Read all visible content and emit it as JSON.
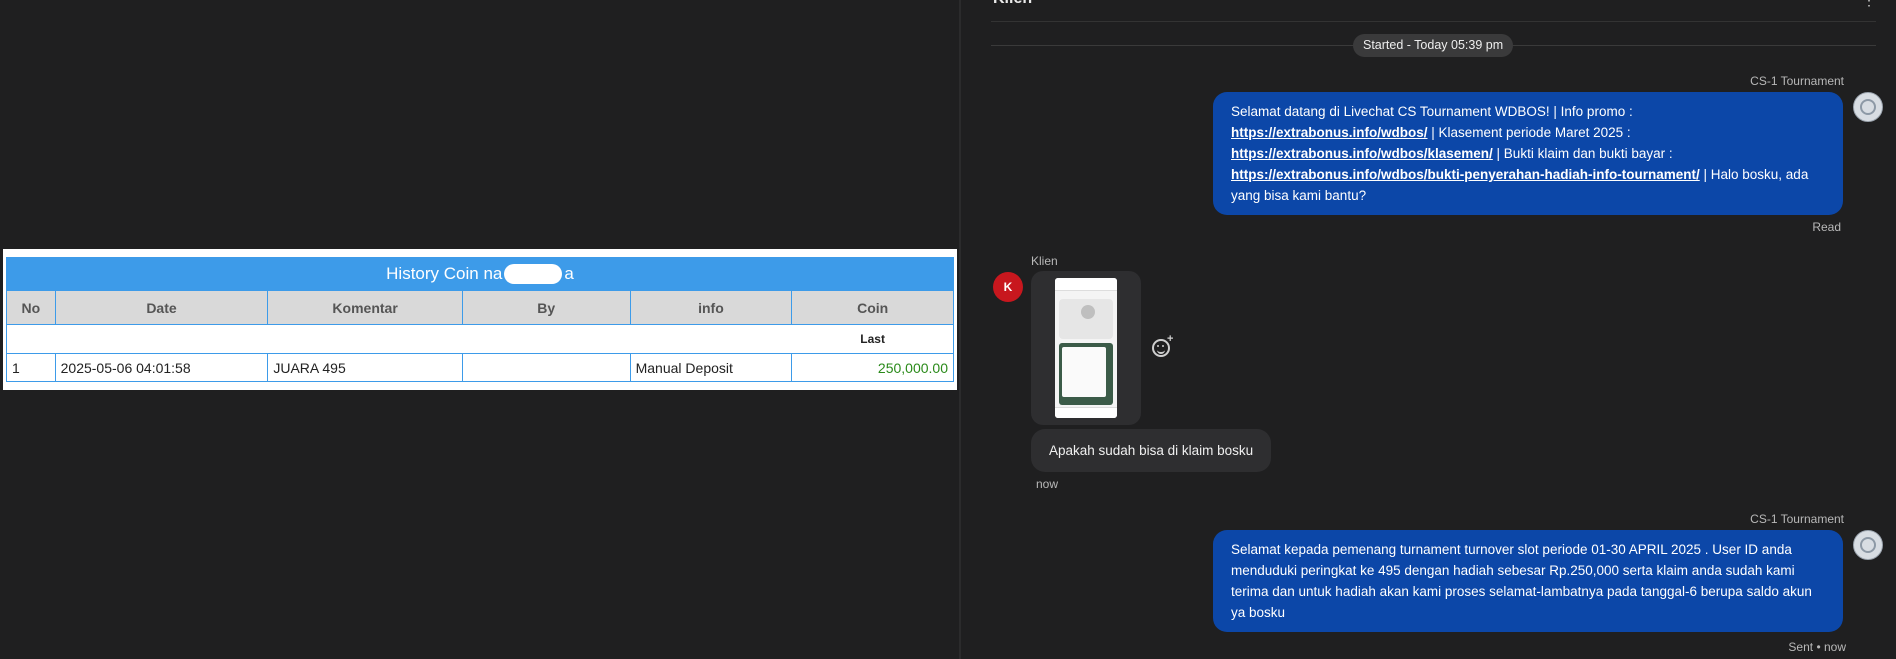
{
  "history": {
    "title_prefix": "History Coin na",
    "title_suffix": "a",
    "columns": [
      "No",
      "Date",
      "Komentar",
      "By",
      "info",
      "Coin"
    ],
    "sub_header": "Last",
    "rows": [
      {
        "no": "1",
        "date": "2025-05-06 04:01:58",
        "komentar": "JUARA 495",
        "by": "",
        "info": "Manual Deposit",
        "coin": "250,000.00"
      }
    ]
  },
  "chat": {
    "contact_name": "Klien",
    "menu_glyph": "⋮",
    "started_label": "Started - Today 05:39 pm",
    "messages": [
      {
        "sender": "CS-1 Tournament",
        "text_1": "Selamat datang di Livechat CS Tournament WDBOS! | Info promo :",
        "link_1": "https://extrabonus.info/wdbos/",
        "text_2": " | Klasement periode Maret 2025 :",
        "link_2": "https://extrabonus.info/wdbos/klasemen/",
        "text_3": " | Bukti klaim dan bukti bayar :",
        "link_3": "https://extrabonus.info/wdbos/bukti-penyerahan-hadiah-info-tournament/",
        "text_4": " | Halo bosku, ada yang bisa kami bantu?",
        "status": "Read"
      },
      {
        "sender": "Klien",
        "avatar_letter": "K",
        "text": "Apakah sudah bisa di klaim bosku",
        "time": "now"
      },
      {
        "sender": "CS-1 Tournament",
        "text": "Selamat kepada pemenang turnament turnover slot periode 01-30 APRIL 2025 . User ID anda menduduki peringkat ke 495 dengan hadiah sebesar Rp.250,000 serta klaim anda sudah kami terima dan untuk hadiah akan kami proses selamat-lambatnya pada tanggal-6 berupa saldo akun ya bosku",
        "status": "Sent • now"
      }
    ],
    "colors": {
      "outgoing_bubble": "#0c47a8",
      "incoming_bubble": "#2e2e30",
      "avatar_klien": "#c8171e",
      "coin_value": "#2a8a1a",
      "table_accent": "#3d9be9"
    }
  }
}
